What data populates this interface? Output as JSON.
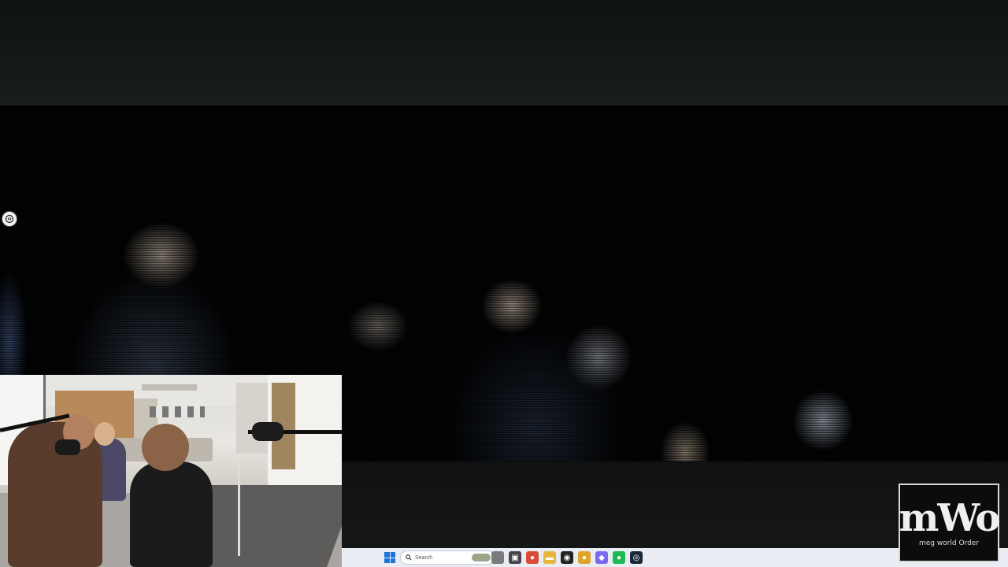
{
  "taskbar": {
    "search_label": "Search",
    "apps": [
      {
        "name": "file-explorer-icon",
        "glyph": "",
        "color": "#7a7a7a"
      },
      {
        "name": "task-view-icon",
        "glyph": "▣",
        "color": "#444444"
      },
      {
        "name": "chrome-icon",
        "glyph": "●",
        "color": "#d94b3a"
      },
      {
        "name": "folder-icon",
        "glyph": "▬",
        "color": "#e7b53c"
      },
      {
        "name": "media-icon",
        "glyph": "◉",
        "color": "#222222"
      },
      {
        "name": "chrome-alt-icon",
        "glyph": "●",
        "color": "#e0a32a"
      },
      {
        "name": "discord-icon",
        "glyph": "◆",
        "color": "#7b6af0"
      },
      {
        "name": "spotify-icon",
        "glyph": "●",
        "color": "#1db954"
      },
      {
        "name": "steam-icon",
        "glyph": "◎",
        "color": "#1b2838"
      }
    ]
  },
  "logo": {
    "mark": "mWo",
    "sub": "meg world Order"
  }
}
